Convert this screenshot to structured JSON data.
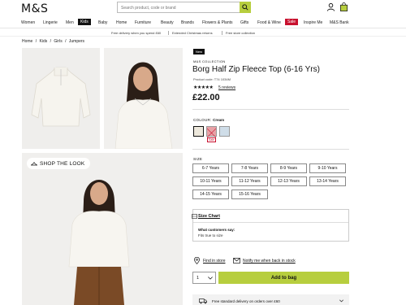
{
  "header": {
    "logo": "M&S",
    "search_placeholder": "Search product, code or brand"
  },
  "nav": {
    "items": [
      "Women",
      "Lingerie",
      "Men",
      "Kids",
      "Baby",
      "Home",
      "Furniture",
      "Beauty",
      "Brands",
      "Flowers & Plants",
      "Gifts",
      "Food & Wine",
      "Sale",
      "Inspire Me",
      "M&S Bank"
    ]
  },
  "promo": {
    "items": [
      "Free delivery when you spend £60",
      "Extended Christmas returns",
      "Free store collection"
    ]
  },
  "breadcrumb": [
    "Home",
    "/",
    "Kids",
    "/",
    "Girls",
    "/",
    "Jumpers"
  ],
  "product": {
    "badge": "New",
    "collection": "M&S COLLECTION",
    "title": "Borg Half Zip Fleece Top (6-16 Yrs)",
    "code": "Product code: T74 1034M",
    "stars": "★★★★★",
    "reviews": "5 reviews",
    "price": "£22.00",
    "colour_label": "COLOUR:",
    "colour_value": "Cream",
    "sale_tag": "Sale",
    "swatches": [
      "#ede8dc",
      "#e8a2a6",
      "#cfdde8"
    ],
    "size_label": "SIZE",
    "sizes": [
      "6-7 Years",
      "7-8 Years",
      "8-9 Years",
      "9-10 Years",
      "10-11 Years",
      "11-12 Years",
      "12-13 Years",
      "13-14 Years",
      "14-15 Years",
      "15-16 Years"
    ],
    "size_chart": "Size Chart",
    "what_customers_say": "What customers say:",
    "fit": "Fits true to size",
    "find_in_store": "Find in store",
    "notify": "Notify me when back in stock",
    "quantity": "1",
    "add_to_bag": "Add to bag",
    "delivery": "Free standard delivery on orders over £60"
  },
  "shop_the_look": "SHOP THE LOOK",
  "colors": {
    "accent": "#b7ce3e",
    "sale": "#c8102e"
  }
}
